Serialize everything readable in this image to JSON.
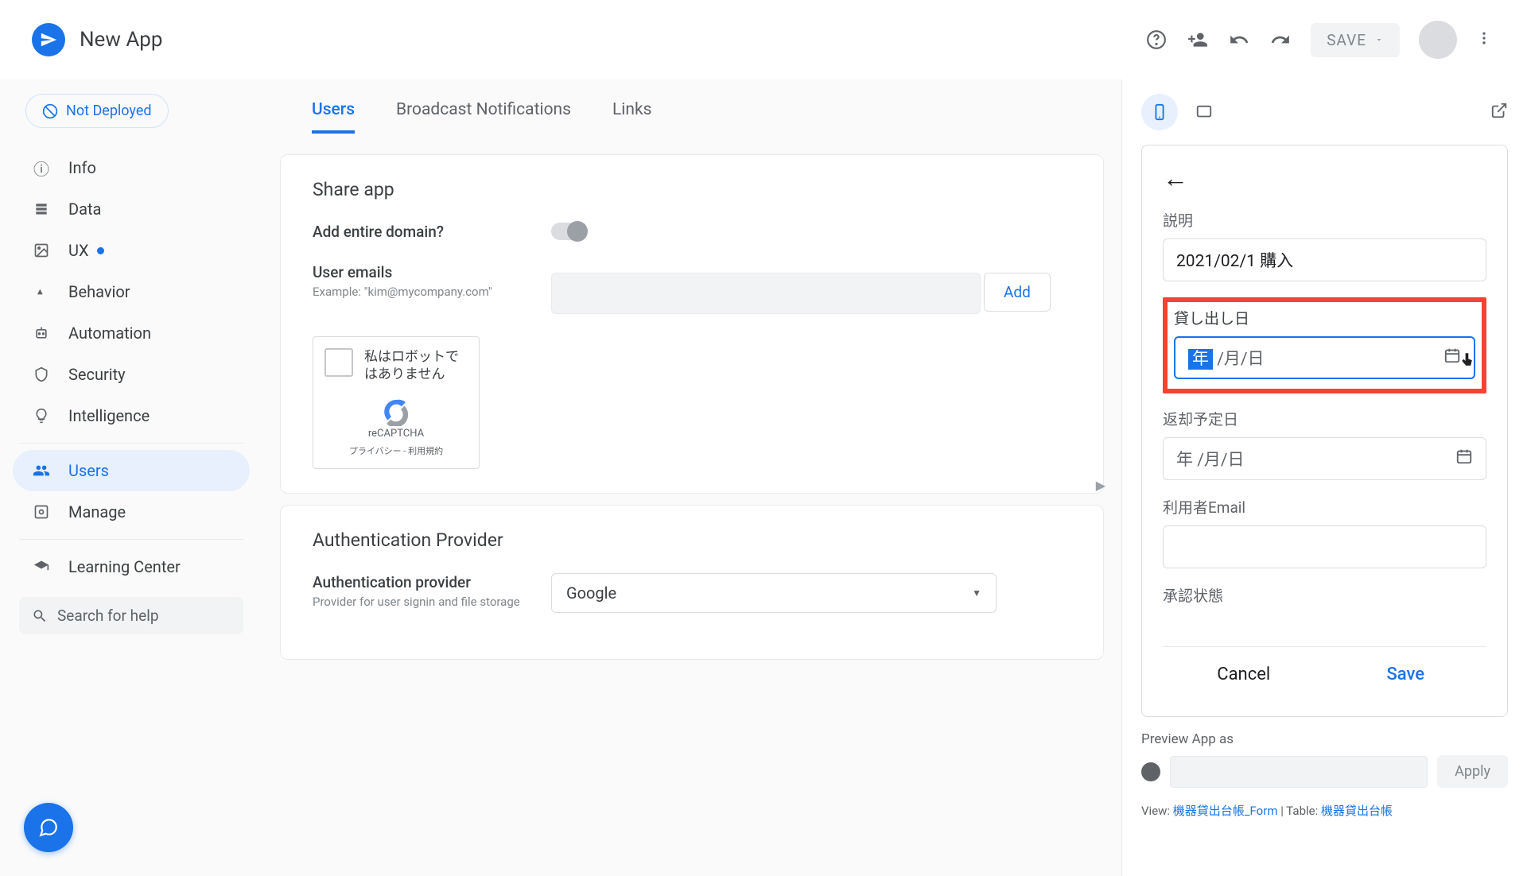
{
  "header": {
    "app_title": "New App",
    "save_label": "SAVE"
  },
  "sidebar": {
    "deploy_status": "Not Deployed",
    "items": [
      {
        "label": "Info"
      },
      {
        "label": "Data"
      },
      {
        "label": "UX"
      },
      {
        "label": "Behavior"
      },
      {
        "label": "Automation"
      },
      {
        "label": "Security"
      },
      {
        "label": "Intelligence"
      },
      {
        "label": "Users"
      },
      {
        "label": "Manage"
      }
    ],
    "learning_center": "Learning Center",
    "search_placeholder": "Search for help"
  },
  "tabs": {
    "users": "Users",
    "broadcast": "Broadcast Notifications",
    "links": "Links"
  },
  "share_card": {
    "title": "Share app",
    "domain_label": "Add entire domain?",
    "emails_label": "User emails",
    "emails_example": "Example: \"kim@mycompany.com\"",
    "add_btn": "Add",
    "captcha_text": "私はロボットではありません",
    "captcha_brand": "reCAPTCHA",
    "captcha_links": "プライバシー - 利用規約"
  },
  "auth_card": {
    "title": "Authentication Provider",
    "provider_label": "Authentication provider",
    "provider_sub": "Provider for user signin and file storage",
    "provider_value": "Google"
  },
  "preview": {
    "form": {
      "desc_label": "説明",
      "desc_value": "2021/02/1 購入",
      "lend_label": "貸し出し日",
      "date_year": "年",
      "date_rest": " /月/日",
      "return_label": "返却予定日",
      "email_label": "利用者Email",
      "status_label": "承認状態",
      "cancel": "Cancel",
      "save": "Save"
    },
    "preview_as_label": "Preview App as",
    "apply": "Apply",
    "view_label": "View: ",
    "view_value": "機器貸出台帳_Form",
    "table_label": "  |  Table: ",
    "table_value": "機器貸出台帳"
  }
}
